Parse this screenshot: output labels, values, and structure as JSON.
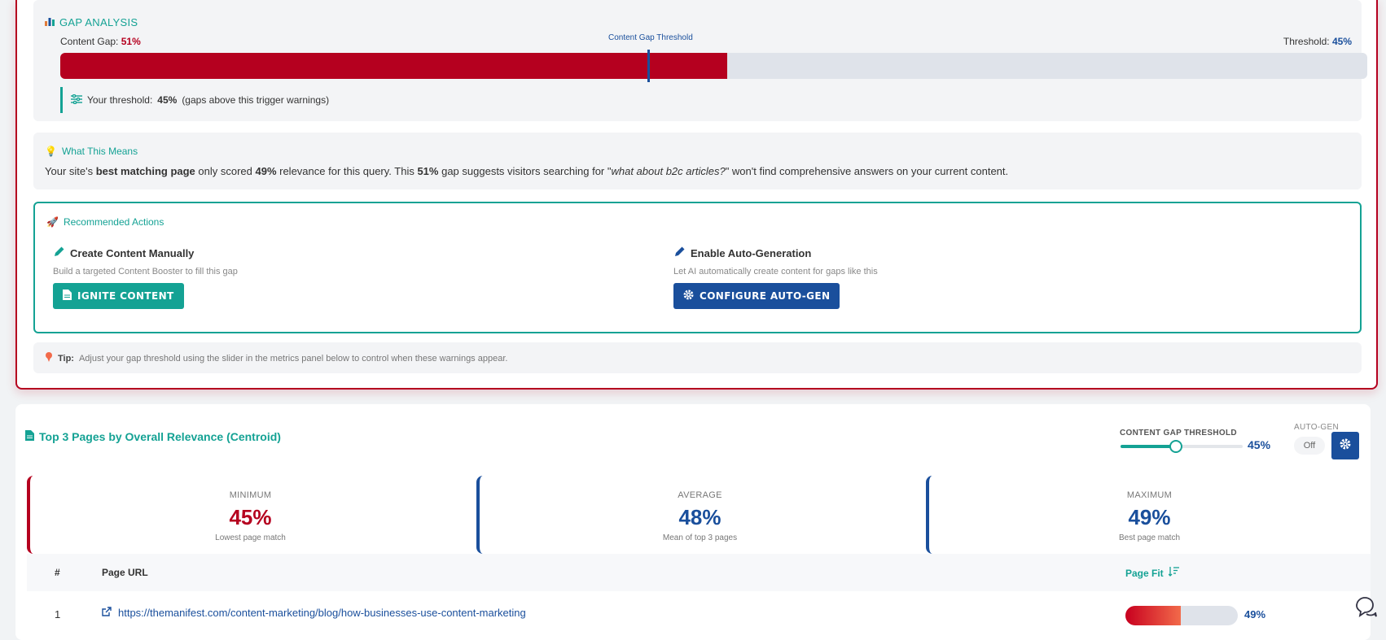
{
  "gap": {
    "title": "GAP ANALYSIS",
    "content_gap_label": "Content Gap:",
    "content_gap_value": "51%",
    "content_gap_fraction": 0.51,
    "threshold_label": "Threshold:",
    "threshold_value": "45%",
    "threshold_fraction": 0.45,
    "marker_label": "Content Gap Threshold",
    "note_prefix": "Your threshold:",
    "note_value": "45%",
    "note_suffix": "(gaps above this trigger warnings)"
  },
  "means": {
    "title": "What This Means",
    "t1": "Your site's ",
    "b1": "best matching page",
    "t2": " only scored ",
    "b2": "49%",
    "t3": " relevance for this query. This ",
    "b3": "51%",
    "t4": " gap suggests visitors searching for \"",
    "query": "what about b2c articles?",
    "t5": "\" won't find comprehensive answers on your current content."
  },
  "recommended": {
    "title": "Recommended Actions",
    "manual_title": "Create Content Manually",
    "manual_sub": "Build a targeted Content Booster to fill this gap",
    "manual_button": "IGNITE CONTENT",
    "auto_title": "Enable Auto-Generation",
    "auto_sub": "Let AI automatically create content for gaps like this",
    "auto_button": "CONFIGURE AUTO-GEN"
  },
  "tip": {
    "label": "Tip:",
    "text": "Adjust your gap threshold using the slider in the metrics panel below to control when these warnings appear."
  },
  "top": {
    "title": "Top 3 Pages by Overall Relevance (Centroid)",
    "threshold_label": "CONTENT GAP THRESHOLD",
    "threshold_value": "45%",
    "threshold_fraction": 0.45,
    "autogen_label": "AUTO-GEN",
    "autogen_state": "Off",
    "stats": [
      {
        "label": "MINIMUM",
        "value": "45%",
        "sub": "Lowest page match",
        "color": "#b5001f"
      },
      {
        "label": "AVERAGE",
        "value": "48%",
        "sub": "Mean of top 3 pages",
        "color": "#1a4f9c"
      },
      {
        "label": "MAXIMUM",
        "value": "49%",
        "sub": "Best page match",
        "color": "#1a4f9c"
      }
    ],
    "columns": {
      "rank": "#",
      "url": "Page URL",
      "fit": "Page Fit"
    },
    "rows": [
      {
        "rank": "1",
        "url": "https://themanifest.com/content-marketing/blog/how-businesses-use-content-marketing",
        "fit": "49%",
        "fit_fraction": 0.49
      }
    ]
  },
  "colors": {
    "teal": "#14a294",
    "red": "#b5001f",
    "blue": "#1a4f9c"
  }
}
